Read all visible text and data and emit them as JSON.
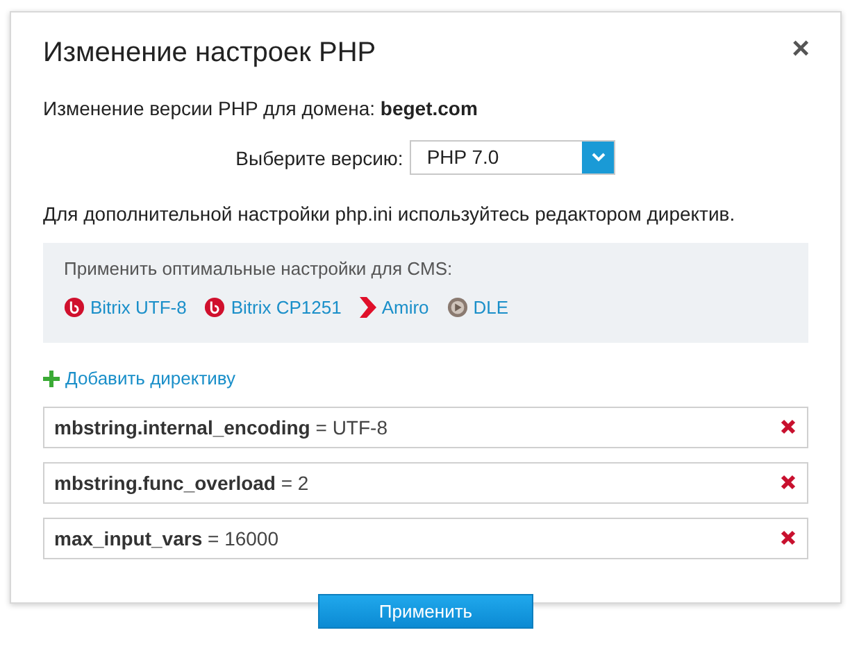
{
  "dialog": {
    "title": "Изменение настроек PHP",
    "close": "×"
  },
  "domain_line": "Изменение версии PHP для домена: **beget.com**",
  "version": {
    "label": "Выберите версию:",
    "value": "PHP 7.0"
  },
  "info": "Для дополнительной настройки php.ini используйтесь редактором директив.",
  "cms_panel": {
    "heading": "Применить оптимальные настройки для CMS:",
    "links": [
      {
        "label": "Bitrix UTF-8",
        "kind": "bitrix"
      },
      {
        "label": "Bitrix CP1251",
        "kind": "bitrix"
      },
      {
        "label": "Amiro",
        "kind": "amiro"
      },
      {
        "label": "DLE",
        "kind": "dle"
      }
    ]
  },
  "add_directive": "Добавить директиву",
  "directives": [
    {
      "text": "**mbstring.internal_encoding** = UTF-8"
    },
    {
      "text": "**mbstring.func_overload** = 2"
    },
    {
      "text": "**max_input_vars** = 16000"
    }
  ],
  "apply_button": "Применить"
}
